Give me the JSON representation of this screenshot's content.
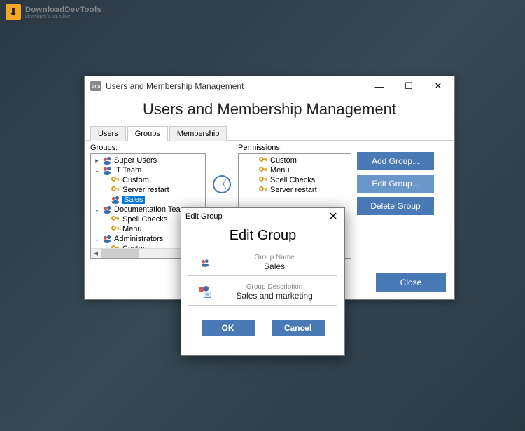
{
  "brand": {
    "title": "DownloadDevTools",
    "sub": "developer's paradise"
  },
  "window": {
    "title": "Users and Membership Management",
    "heading": "Users and Membership Management"
  },
  "tabs": [
    "Users",
    "Groups",
    "Membership"
  ],
  "groups_label": "Groups:",
  "permissions_label": "Permissions:",
  "tree": {
    "items": [
      {
        "name": "Super Users",
        "level": 0,
        "type": "group",
        "caret": "▸"
      },
      {
        "name": "IT Team",
        "level": 0,
        "type": "group",
        "caret": "⌄"
      },
      {
        "name": "Custom",
        "level": 1,
        "type": "key"
      },
      {
        "name": "Server restart",
        "level": 1,
        "type": "key"
      },
      {
        "name": "Sales",
        "level": 1,
        "type": "group",
        "selected": true
      },
      {
        "name": "Documentation Team",
        "level": 0,
        "type": "group",
        "caret": "⌄"
      },
      {
        "name": "Spell Checks",
        "level": 1,
        "type": "key"
      },
      {
        "name": "Menu",
        "level": 1,
        "type": "key"
      },
      {
        "name": "Administrators",
        "level": 0,
        "type": "group",
        "caret": "⌄"
      },
      {
        "name": "Custom",
        "level": 1,
        "type": "key"
      }
    ]
  },
  "permissions": [
    "Custom",
    "Menu",
    "Spell Checks",
    "Server restart"
  ],
  "buttons": {
    "add": "Add Group...",
    "edit": "Edit Group...",
    "delete": "Delete Group",
    "close": "Close"
  },
  "dialog": {
    "title": "Edit Group",
    "heading": "Edit Group",
    "name_label": "Group Name",
    "name_value": "Sales",
    "desc_label": "Group Description",
    "desc_value": "Sales and marketing",
    "ok": "OK",
    "cancel": "Cancel"
  }
}
